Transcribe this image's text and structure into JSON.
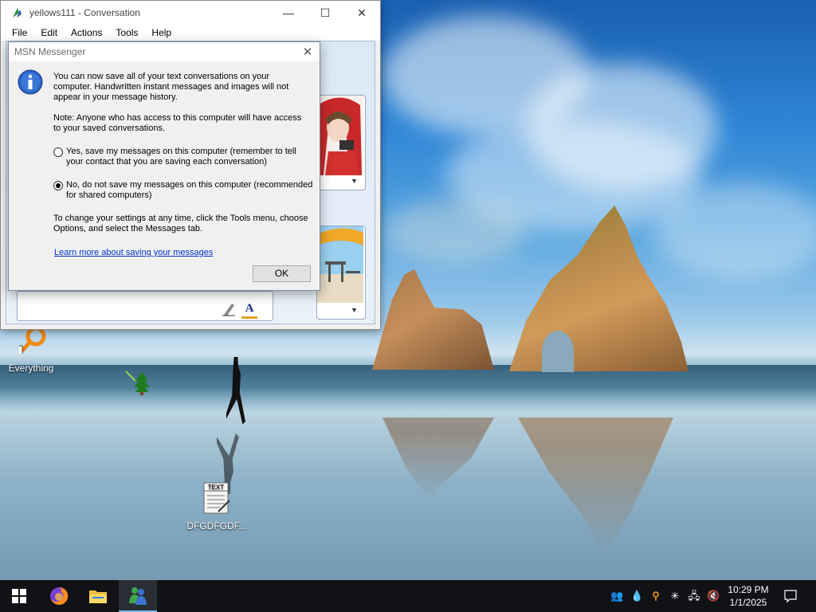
{
  "desktop": {
    "icons": [
      {
        "label": "Everything"
      },
      {
        "label": ""
      },
      {
        "label": "DFGDFGDF...",
        "badge": "TEXT"
      }
    ]
  },
  "conversation": {
    "title": "yellows111 - Conversation",
    "menu": [
      "File",
      "Edit",
      "Actions",
      "Tools",
      "Help"
    ]
  },
  "dialog": {
    "title": "MSN Messenger",
    "para1": "You can now save all of your text conversations on your computer. Handwritten instant messages and images will not appear in your message history.",
    "para2": "Note: Anyone who has access to this computer will have access to your saved conversations.",
    "options": [
      {
        "label": "Yes, save my messages on this computer (remember to tell your contact that you are saving each conversation)",
        "selected": false
      },
      {
        "label": "No, do not save my messages on this computer (recommended for shared computers)",
        "selected": true
      }
    ],
    "para3": "To change your settings at any time, click the Tools menu, choose Options, and select the Messages tab.",
    "link": "Learn more about saving your messages",
    "ok_label": "OK"
  },
  "taskbar": {
    "time": "10:29 PM",
    "date": "1/1/2025",
    "accent": "#76b9ed"
  }
}
